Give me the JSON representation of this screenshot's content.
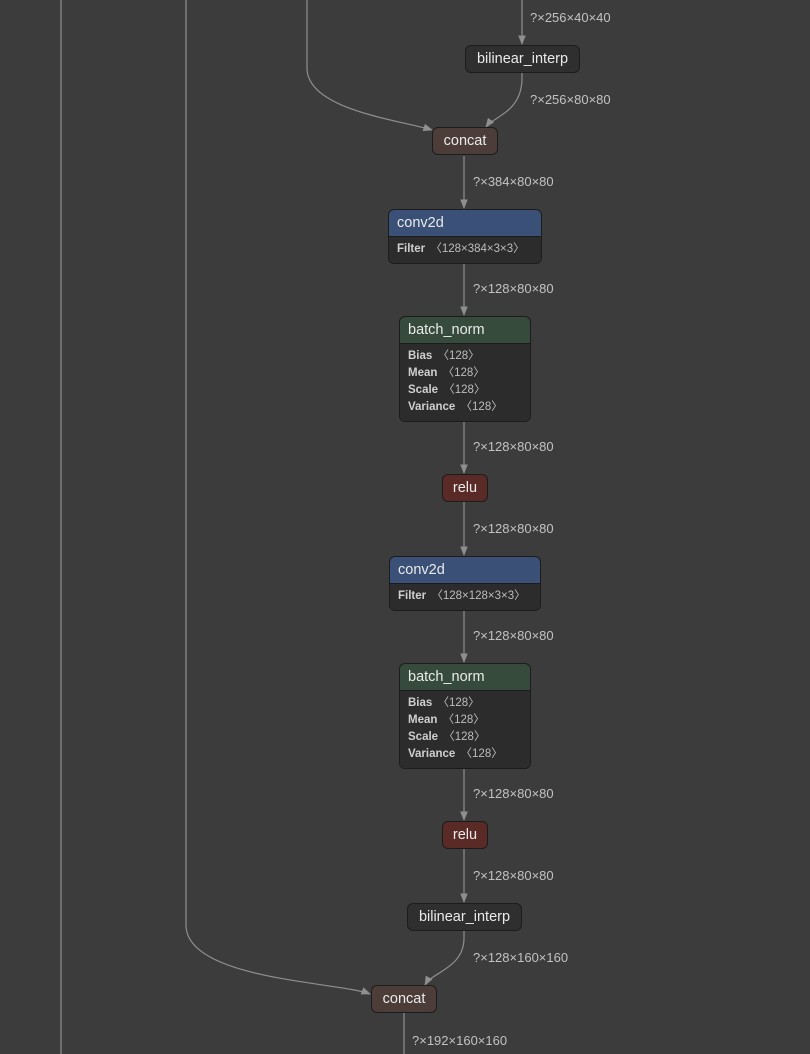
{
  "graph": {
    "edge_labels": {
      "e1": "?×256×40×40",
      "e2": "?×256×80×80",
      "e3": "?×384×80×80",
      "e4": "?×128×80×80",
      "e5": "?×128×80×80",
      "e6": "?×128×80×80",
      "e7": "?×128×80×80",
      "e8": "?×128×80×80",
      "e9": "?×128×80×80",
      "e10": "?×128×160×160",
      "e11": "?×192×160×160"
    },
    "nodes": {
      "interp1": {
        "title": "bilinear_interp"
      },
      "concat1": {
        "title": "concat"
      },
      "conv1": {
        "title": "conv2d",
        "attrs": [
          {
            "key": "Filter",
            "value": "〈128×384×3×3〉"
          }
        ]
      },
      "bn1": {
        "title": "batch_norm",
        "attrs": [
          {
            "key": "Bias",
            "value": "〈128〉"
          },
          {
            "key": "Mean",
            "value": "〈128〉"
          },
          {
            "key": "Scale",
            "value": "〈128〉"
          },
          {
            "key": "Variance",
            "value": "〈128〉"
          }
        ]
      },
      "relu1": {
        "title": "relu"
      },
      "conv2": {
        "title": "conv2d",
        "attrs": [
          {
            "key": "Filter",
            "value": "〈128×128×3×3〉"
          }
        ]
      },
      "bn2": {
        "title": "batch_norm",
        "attrs": [
          {
            "key": "Bias",
            "value": "〈128〉"
          },
          {
            "key": "Mean",
            "value": "〈128〉"
          },
          {
            "key": "Scale",
            "value": "〈128〉"
          },
          {
            "key": "Variance",
            "value": "〈128〉"
          }
        ]
      },
      "relu2": {
        "title": "relu"
      },
      "interp2": {
        "title": "bilinear_interp"
      },
      "concat2": {
        "title": "concat"
      }
    }
  }
}
